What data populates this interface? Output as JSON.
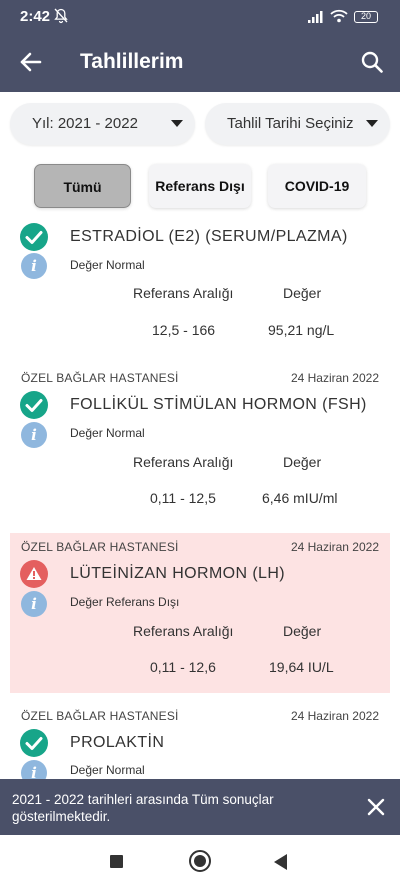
{
  "status_bar": {
    "time": "2:42",
    "battery": "20",
    "icons": [
      "bell-off-icon",
      "signal-icon",
      "wifi-icon",
      "battery-icon"
    ]
  },
  "app_bar": {
    "title": "Tahlillerim",
    "back_icon": "arrow-left-icon",
    "search_icon": "search-icon"
  },
  "dropdowns": {
    "year": "Yıl: 2021 - 2022",
    "date": "Tahlil Tarihi Seçiniz"
  },
  "filters": [
    {
      "label": "Tümü",
      "active": true
    },
    {
      "label": "Referans Dışı",
      "active": false
    },
    {
      "label": "COVID-19",
      "active": false
    }
  ],
  "column_headers": {
    "range": "Referans Aralığı",
    "value": "Değer"
  },
  "results": [
    {
      "hospital": "",
      "date": "",
      "test": "ESTRADİOL (E2) (SERUM/PLAZMA)",
      "status": "normal",
      "note": "Değer Normal",
      "range": "12,5 - 166",
      "value": "95,21 ng/L"
    },
    {
      "hospital": "ÖZEL BAĞLAR HASTANESİ",
      "date": "24 Haziran 2022",
      "test": "FOLLİKÜL STİMÜLAN HORMON (FSH)",
      "status": "normal",
      "note": "Değer Normal",
      "range": "0,11 - 12,5",
      "value": "6,46 mIU/ml"
    },
    {
      "hospital": "ÖZEL BAĞLAR HASTANESİ",
      "date": "24 Haziran 2022",
      "test": "LÜTEİNİZAN HORMON (LH)",
      "status": "out_of_range",
      "note": "Değer Referans Dışı",
      "range": "0,11 - 12,6",
      "value": "19,64 IU/L"
    },
    {
      "hospital": "ÖZEL BAĞLAR HASTANESİ",
      "date": "24 Haziran 2022",
      "test": "PROLAKTİN",
      "status": "normal",
      "note": "Değer Normal",
      "range": "",
      "value": ""
    }
  ],
  "snackbar": {
    "message": "2021 - 2022 tarihleri arasında Tüm sonuçlar gösterilmektedir."
  },
  "colors": {
    "bar": "#4a5068",
    "ok": "#17a589",
    "warn": "#e45f5f",
    "info": "#8fb7de",
    "alert_bg": "#fde3e3"
  }
}
